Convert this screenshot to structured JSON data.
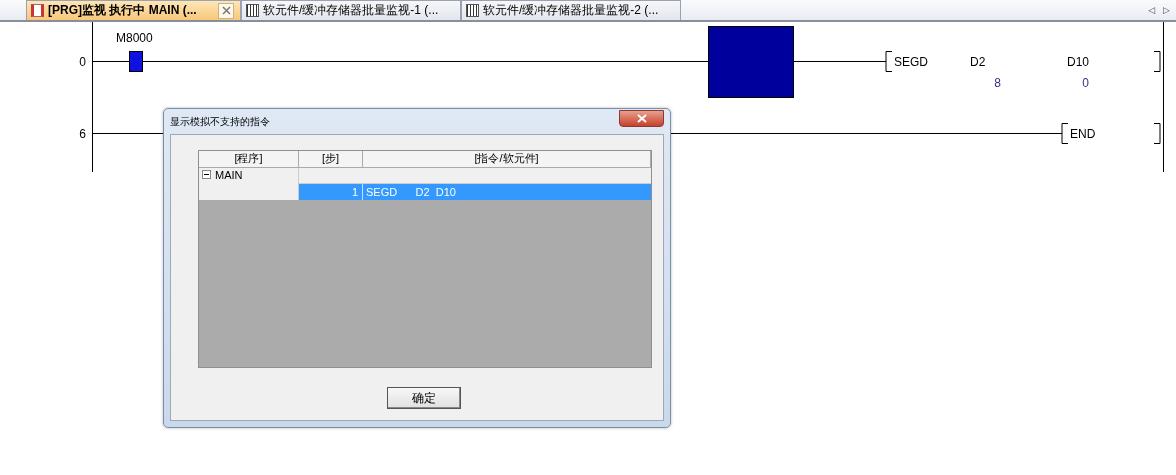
{
  "tabs": [
    {
      "label": "[PRG]监视 执行中 MAIN (...",
      "selected": true,
      "kind": "ladder"
    },
    {
      "label": "软元件/缓冲存储器批量监视-1 (...",
      "selected": false,
      "kind": "grid"
    },
    {
      "label": "软元件/缓冲存储器批量监视-2 (...",
      "selected": false,
      "kind": "grid"
    }
  ],
  "rungs": [
    {
      "step": "0",
      "contact": {
        "label": "M8000",
        "on": true
      },
      "cursor": true,
      "instruction": {
        "op": "SEGD",
        "operands": [
          {
            "name": "D2",
            "value": "8"
          },
          {
            "name": "D10",
            "value": "0"
          }
        ]
      }
    },
    {
      "step": "6",
      "instruction": {
        "op": "END"
      }
    }
  ],
  "scroll_arrows": [
    "◁",
    "▷"
  ],
  "dialog": {
    "title": "显示模拟不支持的指令",
    "columns": [
      "[程序]",
      "[步]",
      "[指令/软元件]"
    ],
    "groups": [
      {
        "name": "MAIN",
        "expanded": true,
        "rows": [
          {
            "step": "1",
            "instruction": "SEGD      D2  D10",
            "selected": true
          }
        ]
      }
    ],
    "button": "确定"
  }
}
